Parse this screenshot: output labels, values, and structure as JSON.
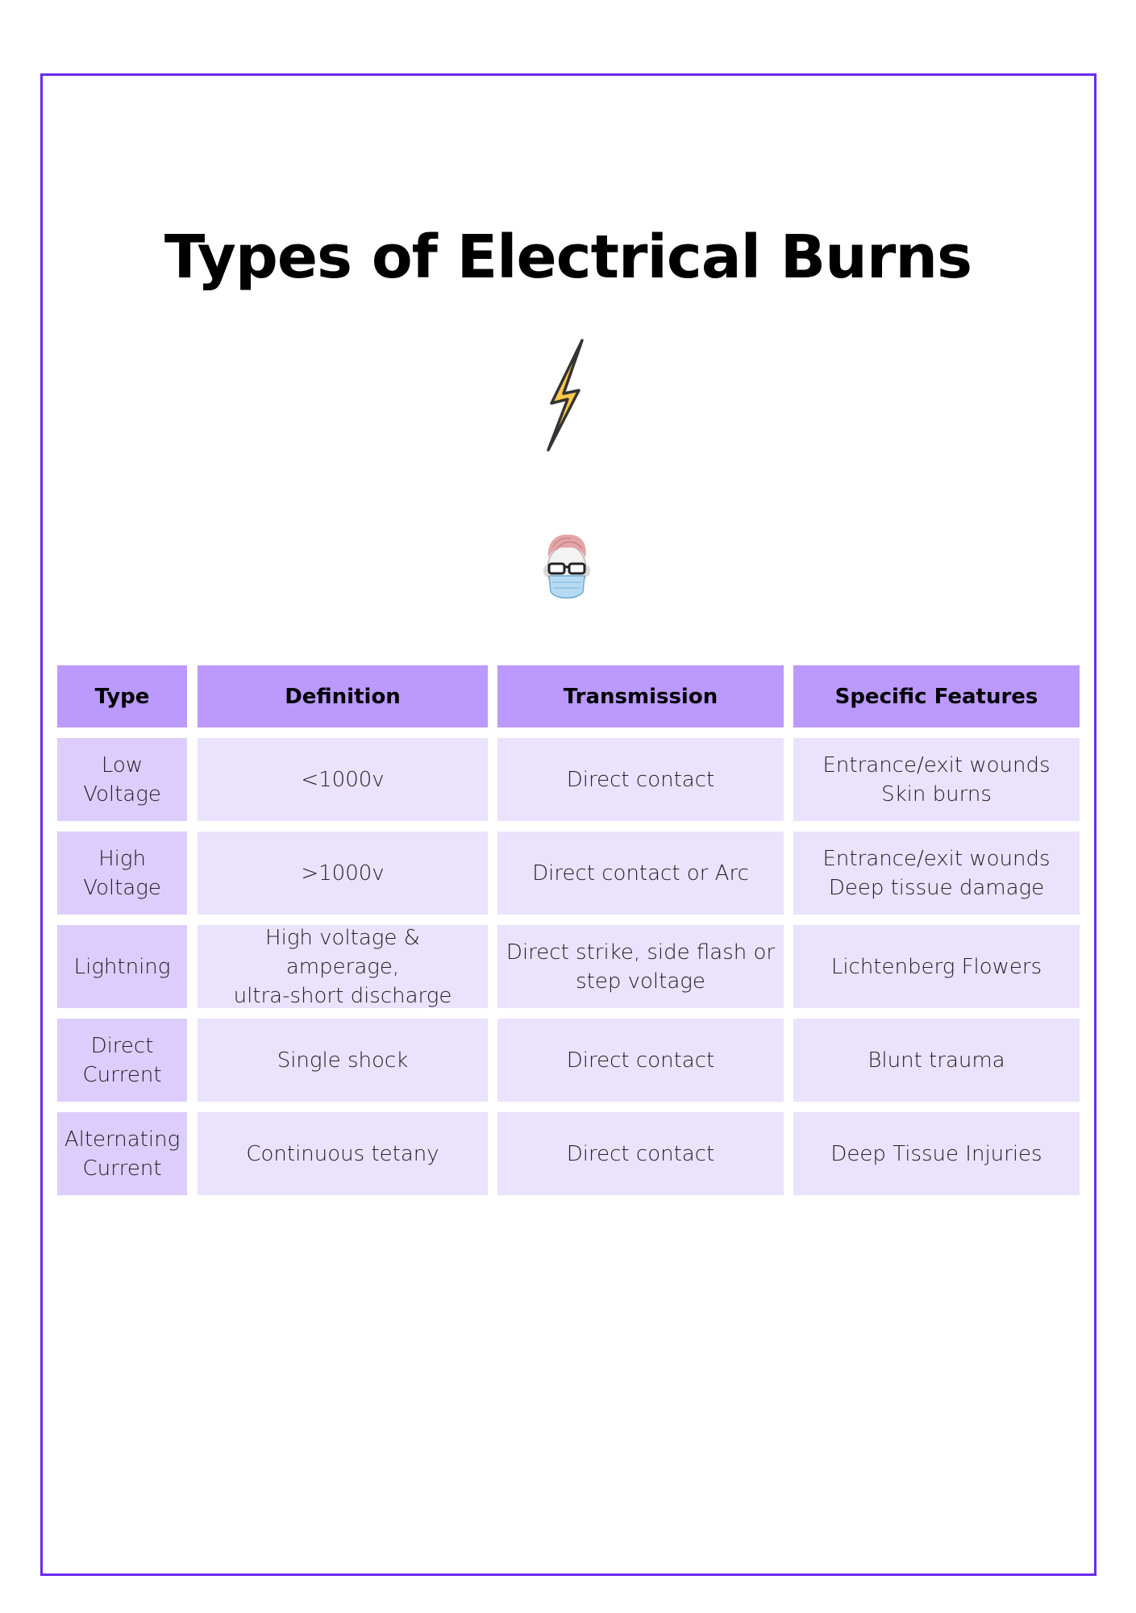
{
  "document": {
    "title": "Types of Electrical Burns",
    "icons": {
      "top_icon": "lightning-bolt-icon",
      "bottom_icon": "doctor-with-mask-icon"
    },
    "colors": {
      "frame_border": "#6a2bf0",
      "header_bg": "#bb99fd",
      "type_cell_bg": "#dccdfd",
      "body_cell_bg": "#ebe2fd",
      "bolt_fill": "#ffc94a",
      "bolt_stroke": "#333333"
    }
  },
  "table": {
    "headers": [
      "Type",
      "Definition",
      "Transmission",
      "Specific Features"
    ],
    "rows": [
      {
        "type": "Low\nVoltage",
        "definition": "<1000v",
        "transmission": "Direct contact",
        "features": "Entrance/exit wounds\nSkin burns"
      },
      {
        "type": "High\nVoltage",
        "definition": ">1000v",
        "transmission": "Direct contact or Arc",
        "features": "Entrance/exit wounds\nDeep tissue damage"
      },
      {
        "type": "Lightning",
        "definition": "High voltage & amperage,\nultra-short discharge",
        "transmission": "Direct strike, side flash or\nstep voltage",
        "features": "Lichtenberg Flowers"
      },
      {
        "type": "Direct\nCurrent",
        "definition": "Single shock",
        "transmission": "Direct contact",
        "features": "Blunt trauma"
      },
      {
        "type": "Alternating\nCurrent",
        "definition": "Continuous tetany",
        "transmission": "Direct contact",
        "features": "Deep Tissue Injuries"
      }
    ]
  }
}
